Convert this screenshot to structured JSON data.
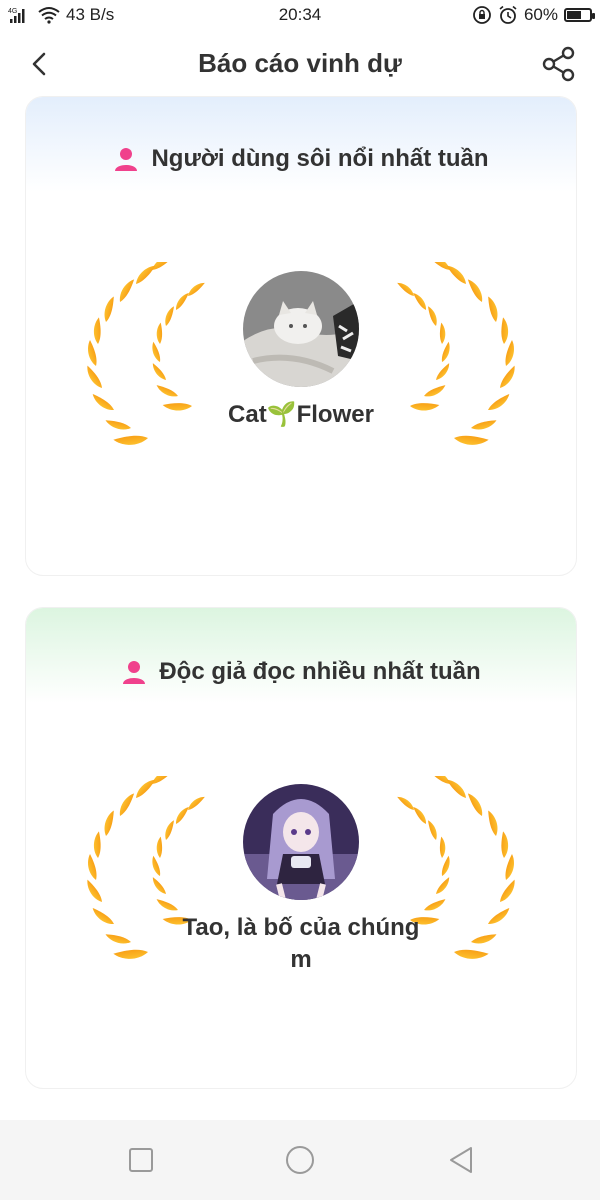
{
  "status_bar": {
    "network": "4G",
    "speed": "43 B/s",
    "time": "20:34",
    "battery": "60%",
    "battery_level": 0.6
  },
  "header": {
    "title": "Báo cáo vinh dự",
    "back_icon": "chevron-left-icon",
    "share_icon": "share-icon"
  },
  "cards": [
    {
      "heading": "Người dùng sôi nổi nhất tuần",
      "user_name": "Cat🌱Flower",
      "header_color": "#e3eefc"
    },
    {
      "heading": "Độc giả đọc nhiều nhất tuần",
      "user_name": "Tao, là bố của chúng m",
      "header_color": "#dcf5e0"
    }
  ],
  "colors": {
    "accent_pink": "#f0418c",
    "laurel_gold": "#f7b500",
    "laurel_orange": "#f58a07"
  }
}
